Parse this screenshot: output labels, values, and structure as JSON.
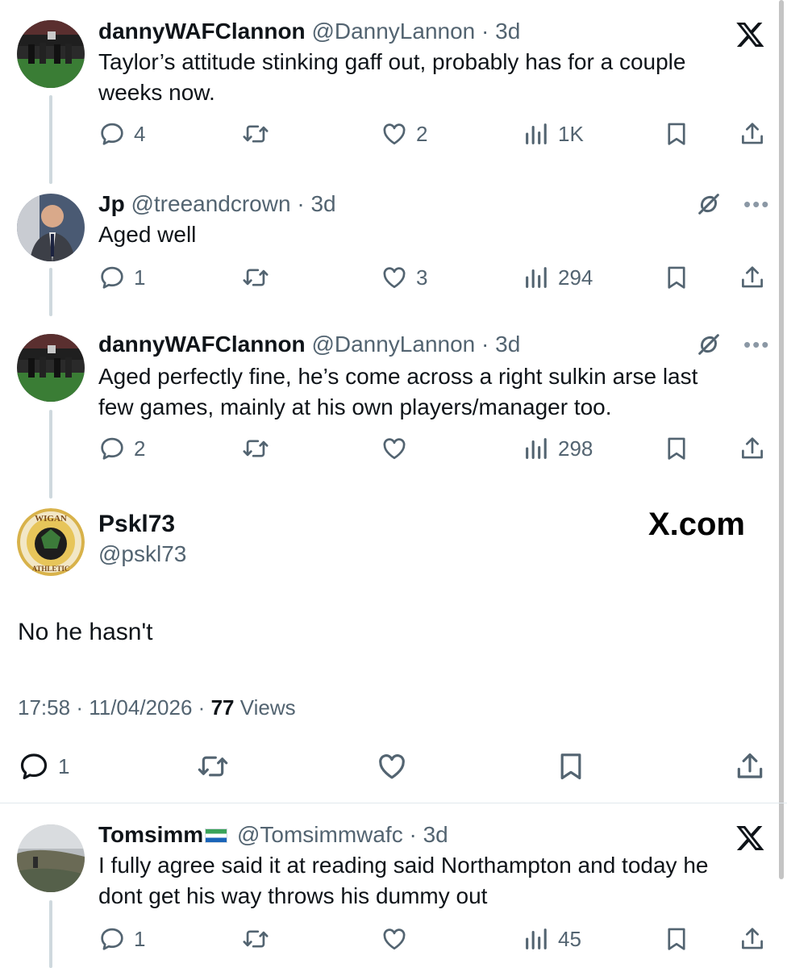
{
  "tweets": [
    {
      "name": "dannyWAFClannon",
      "handle": "@DannyLannon",
      "separator": "·",
      "age": "3d",
      "text_lines": [
        "Taylor’s attitude stinking gaff out, probably has for a couple",
        "weeks now."
      ],
      "replies": "4",
      "reposts": "",
      "likes": "2",
      "views": "1K"
    },
    {
      "name": "Jp",
      "handle": "@treeandcrown",
      "separator": "·",
      "age": "3d",
      "text_lines": [
        "Aged well"
      ],
      "replies": "1",
      "reposts": "",
      "likes": "3",
      "views": "294",
      "more": "•••"
    },
    {
      "name": "dannyWAFClannon",
      "handle": "@DannyLannon",
      "separator": "·",
      "age": "3d",
      "text_lines": [
        "Aged perfectly fine, he’s come across a right sulkin arse last",
        "few games, mainly at his own players/manager too."
      ],
      "replies": "2",
      "reposts": "",
      "likes": "",
      "views": "298",
      "more": "•••"
    }
  ],
  "main_tweet": {
    "name": "Pskl73",
    "handle": "@pskl73",
    "watermark": "X.com",
    "text": "No he hasn't",
    "time": "17:58",
    "separator": "·",
    "date": "11/04/2026",
    "views_count": "77",
    "views_label": "Views",
    "replies": "1",
    "avatar_text": "WIGAN",
    "avatar_text_bottom": "ATHLETIC"
  },
  "reply": {
    "name": "Tomsimm",
    "handle": "@Tomsimmwafc",
    "separator": "·",
    "age": "3d",
    "text_lines": [
      "I fully agree said it at reading said Northampton and today he",
      "dont get his way throws his dummy out"
    ],
    "replies": "1",
    "reposts": "",
    "likes": "",
    "views": "45"
  },
  "colors": {
    "text": "#0f1419",
    "secondary": "#536471",
    "thread_line": "#cfd9de",
    "flag": [
      "#3aa35a",
      "#ffffff",
      "#1a64b8"
    ]
  },
  "icons": [
    "reply-icon",
    "repost-icon",
    "like-icon",
    "views-icon",
    "bookmark-icon",
    "share-icon",
    "x-logo-icon",
    "grok-icon",
    "more-icon"
  ]
}
